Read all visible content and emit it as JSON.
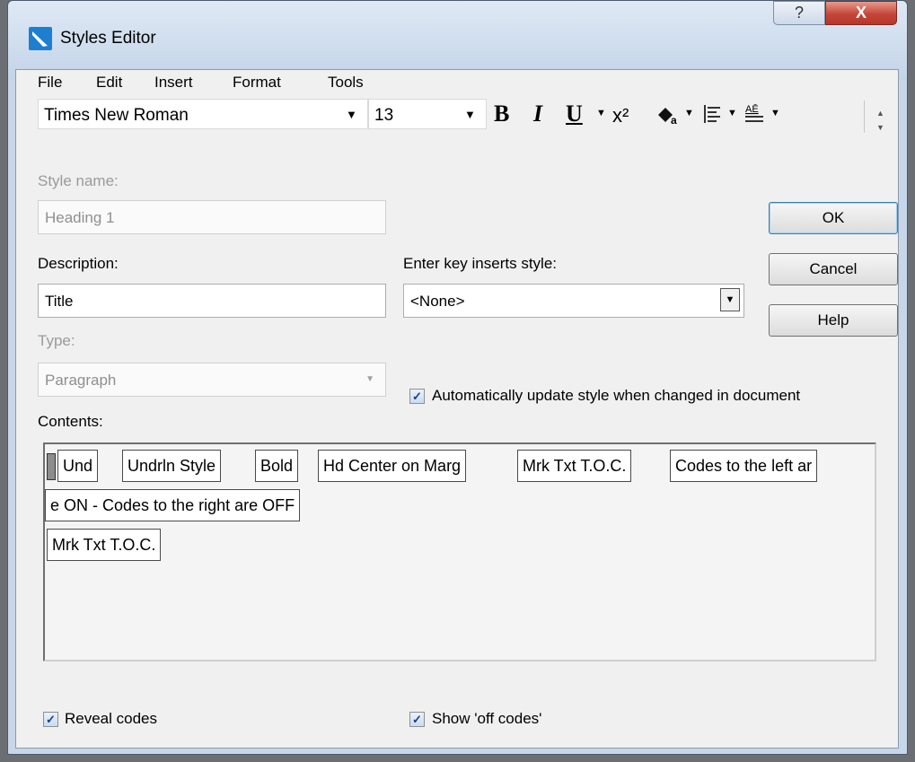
{
  "window": {
    "title": "Styles Editor",
    "help_glyph": "?",
    "close_glyph": "X"
  },
  "menu": [
    "File",
    "Edit",
    "Insert",
    "Format",
    "Tools"
  ],
  "toolbar": {
    "font_name": "Times New Roman",
    "font_size": "13",
    "bold": "B",
    "italic": "I",
    "underline": "U",
    "superscript": "x²",
    "scroll_up": "▲",
    "scroll_down": "▼"
  },
  "form": {
    "style_name_label": "Style name:",
    "style_name_value": "Heading 1",
    "description_label": "Description:",
    "description_value": "Title",
    "type_label": "Type:",
    "type_value": "Paragraph",
    "enter_key_label": "Enter key inserts style:",
    "enter_key_value": "<None>",
    "auto_update_label": "Automatically update style when changed in document",
    "auto_update_checked": true,
    "contents_label": "Contents:"
  },
  "buttons": {
    "ok": "OK",
    "cancel": "Cancel",
    "help": "Help"
  },
  "codes": [
    "Und",
    "Undrln Style",
    "Bold",
    "Hd Center on Marg",
    "Mrk Txt T.O.C.",
    "Codes to the left ar",
    "e ON - Codes to the right are OFF",
    "Mrk Txt T.O.C."
  ],
  "footer": {
    "reveal_codes_label": "Reveal codes",
    "reveal_codes_checked": true,
    "show_off_codes_label": "Show 'off codes'",
    "show_off_codes_checked": true
  },
  "checkmark": "✓",
  "colors": {
    "title_bar": "#c7d6e8",
    "close_button": "#c4473a",
    "default_button_border": "#3c7fb1"
  }
}
